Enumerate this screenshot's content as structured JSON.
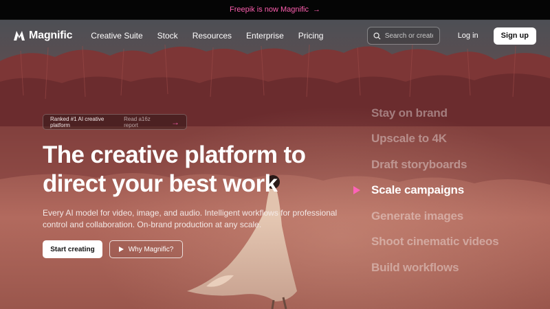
{
  "announcement": {
    "text": "Freepik is now Magnific",
    "arrow": "→"
  },
  "nav": {
    "brand": "Magnific",
    "links": [
      "Creative Suite",
      "Stock",
      "Resources",
      "Enterprise",
      "Pricing"
    ],
    "search_placeholder": "Search or create",
    "login": "Log in",
    "signup": "Sign up"
  },
  "hero": {
    "badge_main": "Ranked #1 AI creative platform",
    "badge_sub": "Read a16z report",
    "badge_arrow": "→",
    "headline_line1": "The creative platform to",
    "headline_line2": "direct your best work",
    "subtext": "Every AI model for video, image, and audio. Intelligent workflows for professional control and collaboration. On-brand production at any scale.",
    "primary_cta": "Start creating",
    "secondary_cta": "Why Magnific?"
  },
  "features": {
    "items": [
      "Stay on brand",
      "Upscale to 4K",
      "Draft storyboards",
      "Scale campaigns",
      "Generate images",
      "Shoot cinematic videos",
      "Build workflows"
    ],
    "active_index": 3
  },
  "colors": {
    "accent": "#ff63b8",
    "announcement_link": "#ff5fb0"
  }
}
